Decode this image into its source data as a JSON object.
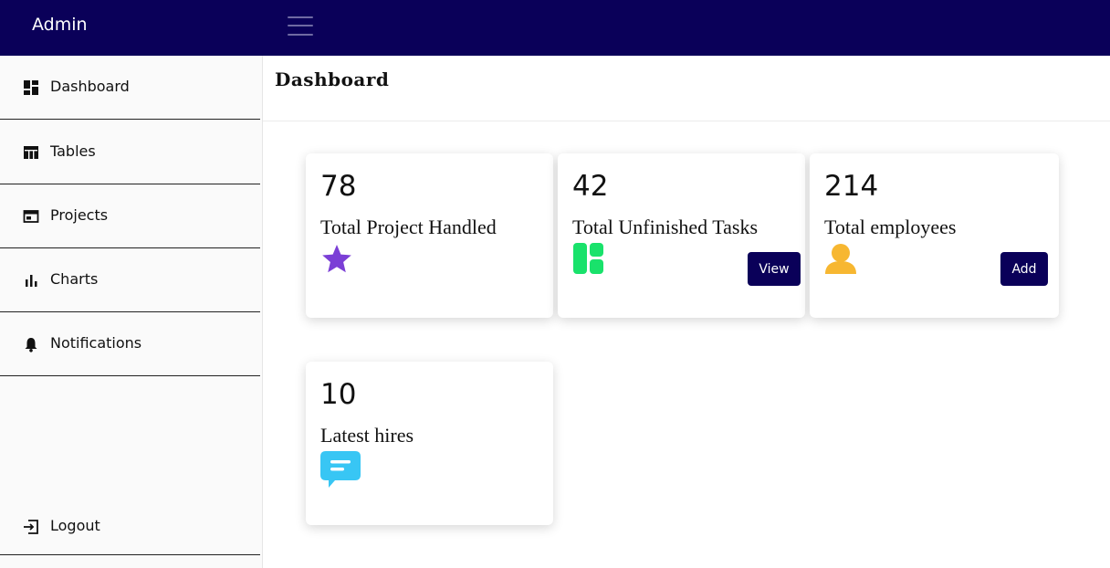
{
  "topbar": {
    "brand": "Admin",
    "menu_icon": "hamburger-menu-icon"
  },
  "sidebar": {
    "items": [
      {
        "label": "Dashboard",
        "icon": "dashboard-icon"
      },
      {
        "label": "Tables",
        "icon": "table-icon"
      },
      {
        "label": "Projects",
        "icon": "projects-icon"
      },
      {
        "label": "Charts",
        "icon": "bar-chart-icon"
      },
      {
        "label": "Notifications",
        "icon": "bell-icon"
      }
    ],
    "logout": {
      "label": "Logout",
      "icon": "logout-icon"
    }
  },
  "main": {
    "title": "Dashboard",
    "cards": [
      {
        "value": "78",
        "label": "Total Project Handled",
        "icon": "star-icon",
        "icon_color": "#7b3fd6"
      },
      {
        "value": "42",
        "label": "Total Unfinished Tasks",
        "icon": "grid-tiles-icon",
        "icon_color": "#19e26b",
        "button": "View"
      },
      {
        "value": "214",
        "label": "Total employees",
        "icon": "person-icon",
        "icon_color": "#f7b731",
        "button": "Add"
      },
      {
        "value": "10",
        "label": "Latest hires",
        "icon": "chat-bubble-icon",
        "icon_color": "#38c6f4"
      }
    ]
  },
  "colors": {
    "topbar": "#0a0059",
    "button": "#0a0059"
  }
}
